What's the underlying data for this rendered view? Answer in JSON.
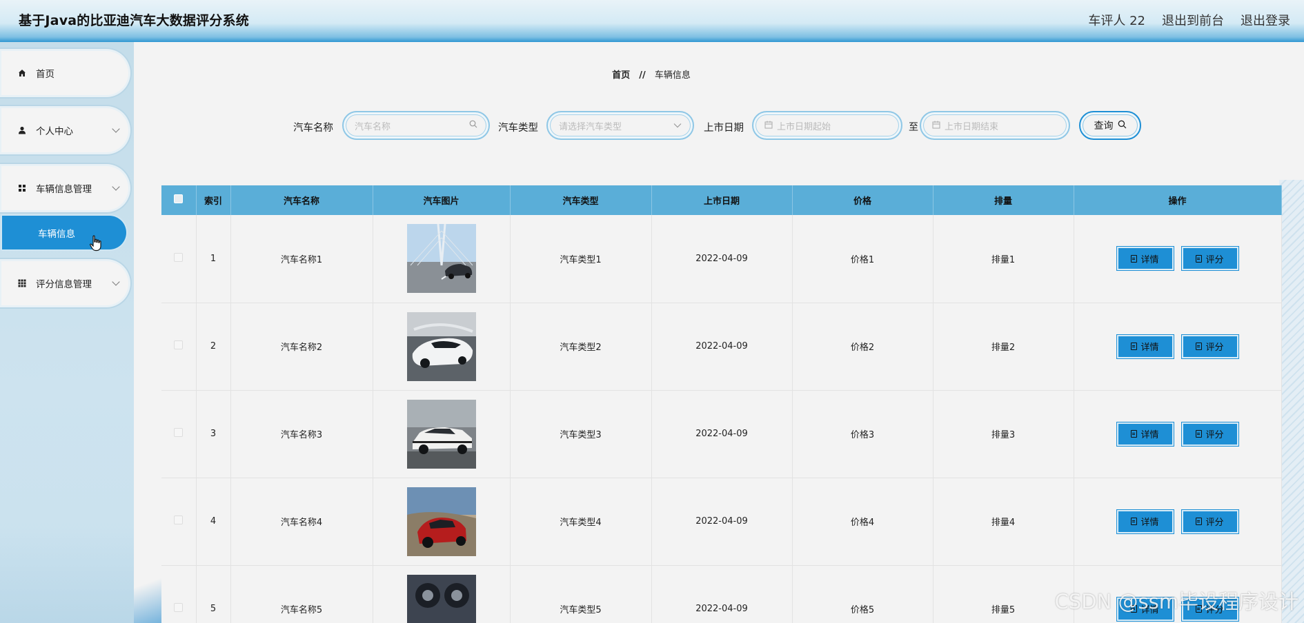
{
  "header": {
    "title": "基于Java的比亚迪汽车大数据评分系统",
    "user": "车评人 22",
    "front_link": "退出到前台",
    "logout_link": "退出登录"
  },
  "sidebar": {
    "items": [
      {
        "label": "首页",
        "icon": "home-icon"
      },
      {
        "label": "个人中心",
        "icon": "user-icon"
      },
      {
        "label": "车辆信息管理",
        "icon": "grid-icon"
      },
      {
        "label": "评分信息管理",
        "icon": "apps-icon"
      }
    ],
    "sub_active": "车辆信息"
  },
  "breadcrumb": {
    "home": "首页",
    "sep": "//",
    "current": "车辆信息"
  },
  "search": {
    "name_label": "汽车名称",
    "name_placeholder": "汽车名称",
    "type_label": "汽车类型",
    "type_placeholder": "请选择汽车类型",
    "date_label": "上市日期",
    "date_start_placeholder": "上市日期起始",
    "to": "至",
    "date_end_placeholder": "上市日期结束",
    "query_label": "查询"
  },
  "table": {
    "headers": [
      "索引",
      "汽车名称",
      "汽车图片",
      "汽车类型",
      "上市日期",
      "价格",
      "排量",
      "操作"
    ],
    "rows": [
      {
        "index": "1",
        "name": "汽车名称1",
        "type": "汽车类型1",
        "date": "2022-04-09",
        "price": "价格1",
        "displacement": "排量1"
      },
      {
        "index": "2",
        "name": "汽车名称2",
        "type": "汽车类型2",
        "date": "2022-04-09",
        "price": "价格2",
        "displacement": "排量2"
      },
      {
        "index": "3",
        "name": "汽车名称3",
        "type": "汽车类型3",
        "date": "2022-04-09",
        "price": "价格3",
        "displacement": "排量3"
      },
      {
        "index": "4",
        "name": "汽车名称4",
        "type": "汽车类型4",
        "date": "2022-04-09",
        "price": "价格4",
        "displacement": "排量4"
      },
      {
        "index": "5",
        "name": "汽车名称5",
        "type": "汽车类型5",
        "date": "2022-04-09",
        "price": "价格5",
        "displacement": "排量5"
      }
    ],
    "detail_label": "详情",
    "rate_label": "评分"
  },
  "watermark": "CSDN @ssm毕设程序设计",
  "colors": {
    "accent": "#1e8fd5",
    "table_header": "#5aaed8",
    "sidebar_bg": "#c9e1ee"
  }
}
